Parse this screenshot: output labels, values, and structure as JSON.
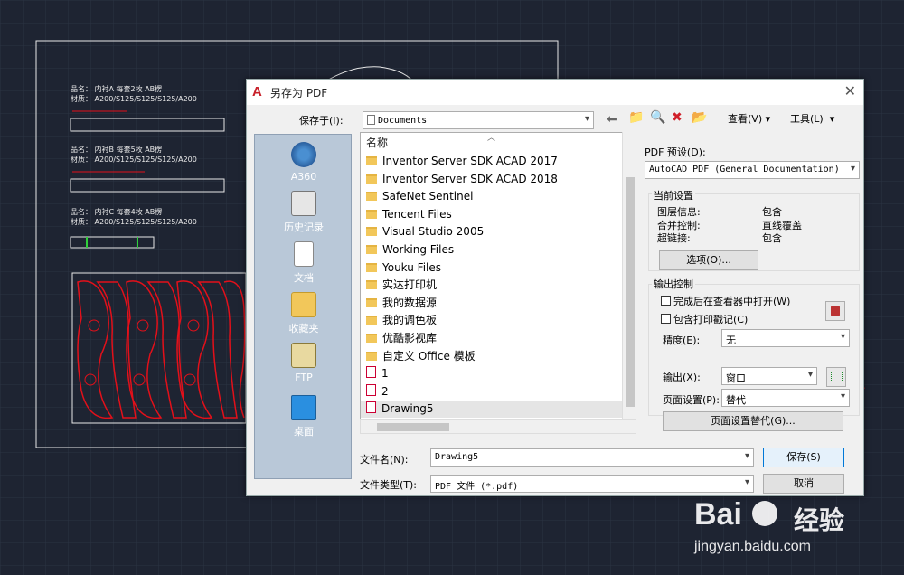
{
  "dialog": {
    "title": "另存为 PDF",
    "logo_letter": "A",
    "close_glyph": "✕",
    "save_in_label": "保存于(I):",
    "save_in_value": "Documents",
    "view_label": "查看(V)",
    "tools_label": "工具(L)",
    "list_header": "名称",
    "files": [
      {
        "name": "Inventor Server SDK ACAD 2017",
        "type": "folder"
      },
      {
        "name": "Inventor Server SDK ACAD 2018",
        "type": "folder"
      },
      {
        "name": "SafeNet Sentinel",
        "type": "folder"
      },
      {
        "name": "Tencent Files",
        "type": "folder"
      },
      {
        "name": "Visual Studio 2005",
        "type": "folder"
      },
      {
        "name": "Working Files",
        "type": "folder"
      },
      {
        "name": "Youku Files",
        "type": "folder"
      },
      {
        "name": "实达打印机",
        "type": "folder"
      },
      {
        "name": "我的数据源",
        "type": "folder"
      },
      {
        "name": "我的调色板",
        "type": "folder"
      },
      {
        "name": "优酷影视库",
        "type": "folder"
      },
      {
        "name": "自定义 Office 模板",
        "type": "folder"
      },
      {
        "name": "1",
        "type": "pdf"
      },
      {
        "name": "2",
        "type": "pdf"
      },
      {
        "name": "Drawing5",
        "type": "pdf"
      }
    ],
    "places": [
      "A360",
      "历史记录",
      "文档",
      "收藏夹",
      "FTP",
      "桌面"
    ],
    "filename_label": "文件名(N):",
    "filename_value": "Drawing5",
    "filetype_label": "文件类型(T):",
    "filetype_value": "PDF 文件 (*.pdf)",
    "save_button": "保存(S)",
    "cancel_button": "取消",
    "pdf_preset_label": "PDF 预设(D):",
    "pdf_preset_value": "AutoCAD PDF (General Documentation)",
    "current_settings_label": "当前设置",
    "settings": [
      {
        "key": "图层信息:",
        "value": "包含"
      },
      {
        "key": "合并控制:",
        "value": "直线覆盖"
      },
      {
        "key": "超链接:",
        "value": "包含"
      }
    ],
    "options_button": "选项(O)...",
    "output_control_label": "输出控制",
    "open_in_viewer_label": "完成后在查看器中打开(W)",
    "include_stamp_label": "包含打印戳记(C)",
    "precision_label": "精度(E):",
    "precision_value": "无",
    "output_label": "输出(X):",
    "output_value": "窗口",
    "page_setup_label": "页面设置(P):",
    "page_setup_value": "替代",
    "page_setup_override_button": "页面设置替代(G)..."
  },
  "cad": {
    "labels": [
      "品名：  内衬A  每套2枚                AB楞",
      "材质：  A200/S125/S125/S125/A200",
      "品名：  内衬B  每套5枚                AB楞",
      "材质：  A200/S125/S125/S125/A200",
      "品名：  内衬C  每套4枚                AB楞",
      "材质：  A200/S125/S125/S125/A200"
    ]
  },
  "watermark": {
    "brand_text": "Bai",
    "brand_cn": "经验",
    "url": "jingyan.baidu.com"
  },
  "colors": {
    "cad_bg": "#1e2432",
    "cad_red": "#e3101a",
    "dialog_bg": "#f0f0f0",
    "places_bg": "#b9c8d8",
    "arrow_red": "#e32020"
  }
}
